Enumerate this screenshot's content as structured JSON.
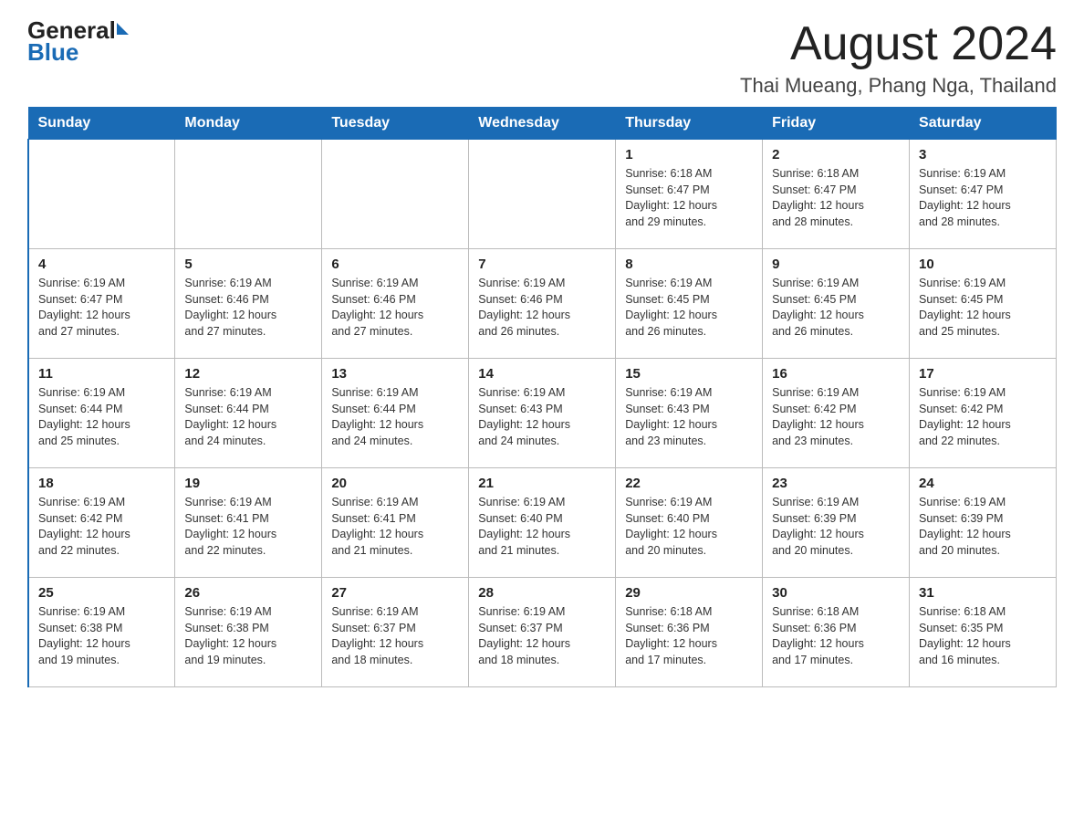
{
  "header": {
    "logo_general": "General",
    "logo_blue": "Blue",
    "title": "August 2024",
    "subtitle": "Thai Mueang, Phang Nga, Thailand"
  },
  "days_of_week": [
    "Sunday",
    "Monday",
    "Tuesday",
    "Wednesday",
    "Thursday",
    "Friday",
    "Saturday"
  ],
  "weeks": [
    [
      {
        "day": "",
        "info": ""
      },
      {
        "day": "",
        "info": ""
      },
      {
        "day": "",
        "info": ""
      },
      {
        "day": "",
        "info": ""
      },
      {
        "day": "1",
        "info": "Sunrise: 6:18 AM\nSunset: 6:47 PM\nDaylight: 12 hours\nand 29 minutes."
      },
      {
        "day": "2",
        "info": "Sunrise: 6:18 AM\nSunset: 6:47 PM\nDaylight: 12 hours\nand 28 minutes."
      },
      {
        "day": "3",
        "info": "Sunrise: 6:19 AM\nSunset: 6:47 PM\nDaylight: 12 hours\nand 28 minutes."
      }
    ],
    [
      {
        "day": "4",
        "info": "Sunrise: 6:19 AM\nSunset: 6:47 PM\nDaylight: 12 hours\nand 27 minutes."
      },
      {
        "day": "5",
        "info": "Sunrise: 6:19 AM\nSunset: 6:46 PM\nDaylight: 12 hours\nand 27 minutes."
      },
      {
        "day": "6",
        "info": "Sunrise: 6:19 AM\nSunset: 6:46 PM\nDaylight: 12 hours\nand 27 minutes."
      },
      {
        "day": "7",
        "info": "Sunrise: 6:19 AM\nSunset: 6:46 PM\nDaylight: 12 hours\nand 26 minutes."
      },
      {
        "day": "8",
        "info": "Sunrise: 6:19 AM\nSunset: 6:45 PM\nDaylight: 12 hours\nand 26 minutes."
      },
      {
        "day": "9",
        "info": "Sunrise: 6:19 AM\nSunset: 6:45 PM\nDaylight: 12 hours\nand 26 minutes."
      },
      {
        "day": "10",
        "info": "Sunrise: 6:19 AM\nSunset: 6:45 PM\nDaylight: 12 hours\nand 25 minutes."
      }
    ],
    [
      {
        "day": "11",
        "info": "Sunrise: 6:19 AM\nSunset: 6:44 PM\nDaylight: 12 hours\nand 25 minutes."
      },
      {
        "day": "12",
        "info": "Sunrise: 6:19 AM\nSunset: 6:44 PM\nDaylight: 12 hours\nand 24 minutes."
      },
      {
        "day": "13",
        "info": "Sunrise: 6:19 AM\nSunset: 6:44 PM\nDaylight: 12 hours\nand 24 minutes."
      },
      {
        "day": "14",
        "info": "Sunrise: 6:19 AM\nSunset: 6:43 PM\nDaylight: 12 hours\nand 24 minutes."
      },
      {
        "day": "15",
        "info": "Sunrise: 6:19 AM\nSunset: 6:43 PM\nDaylight: 12 hours\nand 23 minutes."
      },
      {
        "day": "16",
        "info": "Sunrise: 6:19 AM\nSunset: 6:42 PM\nDaylight: 12 hours\nand 23 minutes."
      },
      {
        "day": "17",
        "info": "Sunrise: 6:19 AM\nSunset: 6:42 PM\nDaylight: 12 hours\nand 22 minutes."
      }
    ],
    [
      {
        "day": "18",
        "info": "Sunrise: 6:19 AM\nSunset: 6:42 PM\nDaylight: 12 hours\nand 22 minutes."
      },
      {
        "day": "19",
        "info": "Sunrise: 6:19 AM\nSunset: 6:41 PM\nDaylight: 12 hours\nand 22 minutes."
      },
      {
        "day": "20",
        "info": "Sunrise: 6:19 AM\nSunset: 6:41 PM\nDaylight: 12 hours\nand 21 minutes."
      },
      {
        "day": "21",
        "info": "Sunrise: 6:19 AM\nSunset: 6:40 PM\nDaylight: 12 hours\nand 21 minutes."
      },
      {
        "day": "22",
        "info": "Sunrise: 6:19 AM\nSunset: 6:40 PM\nDaylight: 12 hours\nand 20 minutes."
      },
      {
        "day": "23",
        "info": "Sunrise: 6:19 AM\nSunset: 6:39 PM\nDaylight: 12 hours\nand 20 minutes."
      },
      {
        "day": "24",
        "info": "Sunrise: 6:19 AM\nSunset: 6:39 PM\nDaylight: 12 hours\nand 20 minutes."
      }
    ],
    [
      {
        "day": "25",
        "info": "Sunrise: 6:19 AM\nSunset: 6:38 PM\nDaylight: 12 hours\nand 19 minutes."
      },
      {
        "day": "26",
        "info": "Sunrise: 6:19 AM\nSunset: 6:38 PM\nDaylight: 12 hours\nand 19 minutes."
      },
      {
        "day": "27",
        "info": "Sunrise: 6:19 AM\nSunset: 6:37 PM\nDaylight: 12 hours\nand 18 minutes."
      },
      {
        "day": "28",
        "info": "Sunrise: 6:19 AM\nSunset: 6:37 PM\nDaylight: 12 hours\nand 18 minutes."
      },
      {
        "day": "29",
        "info": "Sunrise: 6:18 AM\nSunset: 6:36 PM\nDaylight: 12 hours\nand 17 minutes."
      },
      {
        "day": "30",
        "info": "Sunrise: 6:18 AM\nSunset: 6:36 PM\nDaylight: 12 hours\nand 17 minutes."
      },
      {
        "day": "31",
        "info": "Sunrise: 6:18 AM\nSunset: 6:35 PM\nDaylight: 12 hours\nand 16 minutes."
      }
    ]
  ]
}
